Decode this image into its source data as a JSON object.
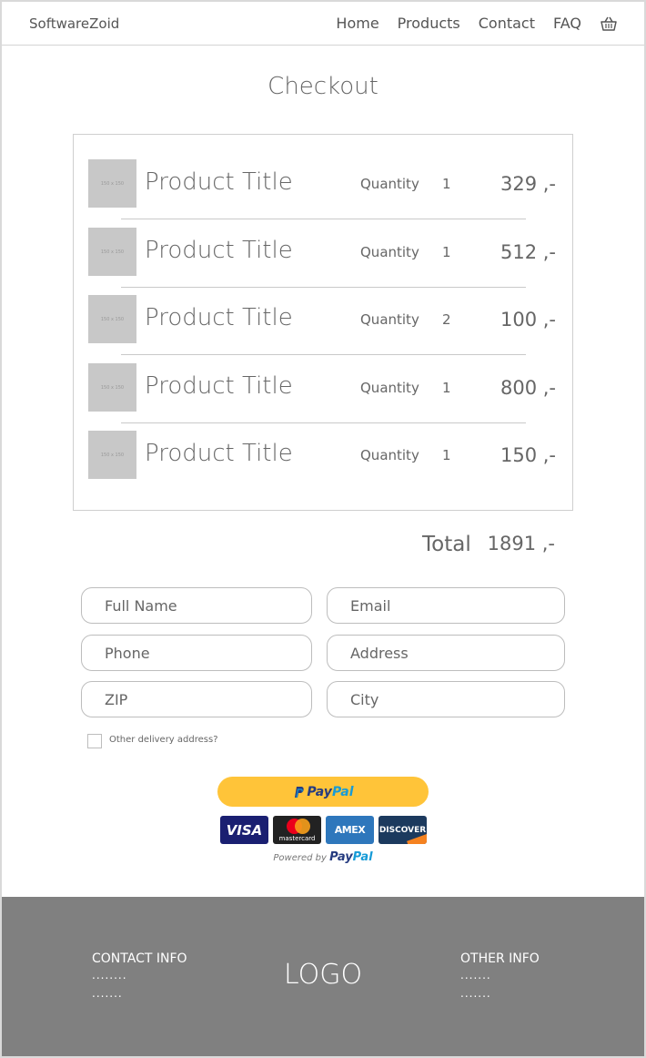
{
  "navbar": {
    "brand": "SoftwareZoid",
    "links": [
      "Home",
      "Products",
      "Contact",
      "FAQ"
    ],
    "cart_icon": "basket-icon"
  },
  "page": {
    "title": "Checkout"
  },
  "cart": {
    "placeholder_text": "150 x 150",
    "items": [
      {
        "title": "Product Title",
        "quantity_label": "Quantity",
        "quantity": "1",
        "price": "329 ,-"
      },
      {
        "title": "Product Title",
        "quantity_label": "Quantity",
        "quantity": "1",
        "price": "512 ,-"
      },
      {
        "title": "Product Title",
        "quantity_label": "Quantity",
        "quantity": "2",
        "price": "100 ,-"
      },
      {
        "title": "Product Title",
        "quantity_label": "Quantity",
        "quantity": "1",
        "price": "800 ,-"
      },
      {
        "title": "Product Title",
        "quantity_label": "Quantity",
        "quantity": "1",
        "price": "150 ,-"
      }
    ],
    "total_label": "Total",
    "total_value": "1891 ,-"
  },
  "form": {
    "full_name_placeholder": "Full Name",
    "email_placeholder": "Email",
    "phone_placeholder": "Phone",
    "address_placeholder": "Address",
    "zip_placeholder": "ZIP",
    "city_placeholder": "City",
    "other_delivery_label": "Other delivery address?"
  },
  "payment": {
    "paypal_button_dark": "Pay",
    "paypal_button_light": "Pal",
    "cards": [
      "VISA",
      "mastercard",
      "AMEX",
      "DISCOVER"
    ],
    "powered_by": "Powered by",
    "powered_brand_dark": "Pay",
    "powered_brand_light": "Pal",
    "colors": {
      "paypal_yellow": "#ffc439",
      "paypal_dark": "#253b80",
      "paypal_light": "#179bd7"
    }
  },
  "footer": {
    "contact_heading": "CONTACT INFO",
    "contact_line1": "........",
    "contact_line2": ".......",
    "logo": "LOGO",
    "other_heading": "OTHER INFO",
    "other_line1": ".......",
    "other_line2": ".......",
    "background": "#808080"
  }
}
